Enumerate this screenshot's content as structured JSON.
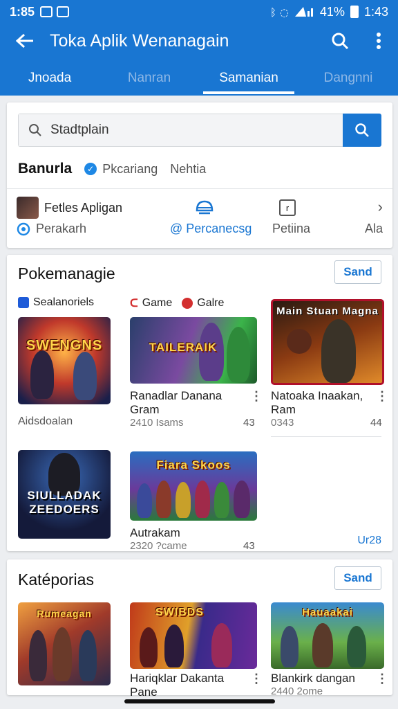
{
  "status": {
    "time": "1:85",
    "battery_text": "41%",
    "clock_right": "1:43"
  },
  "appbar": {
    "title": "Toka Aplik Wenanagain"
  },
  "tabs": [
    {
      "label": "Jnoada",
      "state": "active"
    },
    {
      "label": "Nanran",
      "state": "dim"
    },
    {
      "label": "Samanian",
      "state": "selected"
    },
    {
      "label": "Dangnni",
      "state": "dim"
    }
  ],
  "search": {
    "placeholder": "Stadtplain"
  },
  "filters": {
    "heading": "Banurla",
    "option1": "Pkcariang",
    "option2": "Nehtia"
  },
  "chips_row1": {
    "user_label": "Fetles Apligan"
  },
  "chips_row2": {
    "left": "Perakarh",
    "middle": "@ Percanecsg",
    "right1": "Petiina",
    "right2": "Ala"
  },
  "section1": {
    "title": "Pokemanagie",
    "button": "Sand",
    "categories": [
      "Sealanoriels",
      "Game",
      "Galre"
    ],
    "apps": [
      {
        "thumb_text": "SWENGNS",
        "name": "",
        "meta": "Aidsdoalan",
        "rating": ""
      },
      {
        "thumb_text": "TAILERAIK",
        "name": "Ranadlar Danana Gram",
        "meta": "2410 Isams",
        "rating": "43"
      },
      {
        "thumb_text": "Main Stuan Magna",
        "name": "Natoaka Inaakan, Ram",
        "meta": "0343",
        "rating": "44"
      },
      {
        "thumb_text": "SIULLADAK ZEEDOERS",
        "name": "",
        "meta": "",
        "rating": ""
      },
      {
        "thumb_text": "Fiara Skoos",
        "name": "Autrakam",
        "meta": "2320 ?came",
        "rating": "43"
      }
    ],
    "more_link": "Ur28"
  },
  "section2": {
    "title": "Katéporias",
    "button": "Sand",
    "apps": [
      {
        "thumb_text": "Rumeagan",
        "name": "",
        "meta": ""
      },
      {
        "thumb_text": "SWIBDS",
        "name": "Hariqklar Dakanta Pane",
        "meta": ""
      },
      {
        "thumb_text": "Hauaakai",
        "name": "Blankirk dangan",
        "meta": "2440 2ome"
      }
    ]
  },
  "colors": {
    "primary": "#1976d2",
    "background": "#eceef1"
  }
}
